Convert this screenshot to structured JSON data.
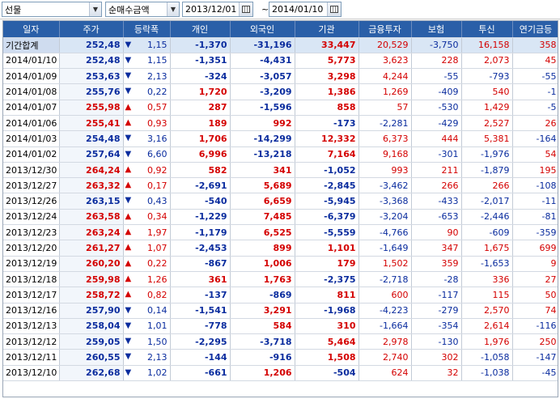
{
  "toolbar": {
    "market_select": "선물",
    "type_select": "순매수금액",
    "date_from": "2013/12/01",
    "date_to": "2014/01/10",
    "tilde": "~"
  },
  "table": {
    "headers": [
      "일자",
      "주가",
      "등락폭",
      "개인",
      "외국인",
      "기관",
      "금융투자",
      "보험",
      "투신",
      "연기금등"
    ],
    "rows": [
      {
        "date": "기간합계",
        "price": "252,48",
        "dir": "down",
        "change": "1,15",
        "individual": "-1,370",
        "foreign": "-31,196",
        "institution": "33,447",
        "financial": "20,529",
        "insurance": "-3,750",
        "trust": "16,158",
        "pension": "358"
      },
      {
        "date": "2014/01/10",
        "price": "252,48",
        "dir": "down",
        "change": "1,15",
        "individual": "-1,351",
        "foreign": "-4,431",
        "institution": "5,773",
        "financial": "3,623",
        "insurance": "228",
        "trust": "2,073",
        "pension": "45"
      },
      {
        "date": "2014/01/09",
        "price": "253,63",
        "dir": "down",
        "change": "2,13",
        "individual": "-324",
        "foreign": "-3,057",
        "institution": "3,298",
        "financial": "4,244",
        "insurance": "-55",
        "trust": "-793",
        "pension": "-55"
      },
      {
        "date": "2014/01/08",
        "price": "255,76",
        "dir": "down",
        "change": "0,22",
        "individual": "1,720",
        "foreign": "-3,209",
        "institution": "1,386",
        "financial": "1,269",
        "insurance": "-409",
        "trust": "540",
        "pension": "-1"
      },
      {
        "date": "2014/01/07",
        "price": "255,98",
        "dir": "up",
        "change": "0,57",
        "individual": "287",
        "foreign": "-1,596",
        "institution": "858",
        "financial": "57",
        "insurance": "-530",
        "trust": "1,429",
        "pension": "-5"
      },
      {
        "date": "2014/01/06",
        "price": "255,41",
        "dir": "up",
        "change": "0,93",
        "individual": "189",
        "foreign": "992",
        "institution": "-173",
        "financial": "-2,281",
        "insurance": "-429",
        "trust": "2,527",
        "pension": "26"
      },
      {
        "date": "2014/01/03",
        "price": "254,48",
        "dir": "down",
        "change": "3,16",
        "individual": "1,706",
        "foreign": "-14,299",
        "institution": "12,332",
        "financial": "6,373",
        "insurance": "444",
        "trust": "5,381",
        "pension": "-164"
      },
      {
        "date": "2014/01/02",
        "price": "257,64",
        "dir": "down",
        "change": "6,60",
        "individual": "6,996",
        "foreign": "-13,218",
        "institution": "7,164",
        "financial": "9,168",
        "insurance": "-301",
        "trust": "-1,976",
        "pension": "54"
      },
      {
        "date": "2013/12/30",
        "price": "264,24",
        "dir": "up",
        "change": "0,92",
        "individual": "582",
        "foreign": "341",
        "institution": "-1,052",
        "financial": "993",
        "insurance": "211",
        "trust": "-1,879",
        "pension": "195"
      },
      {
        "date": "2013/12/27",
        "price": "263,32",
        "dir": "up",
        "change": "0,17",
        "individual": "-2,691",
        "foreign": "5,689",
        "institution": "-2,845",
        "financial": "-3,462",
        "insurance": "266",
        "trust": "266",
        "pension": "-108"
      },
      {
        "date": "2013/12/26",
        "price": "263,15",
        "dir": "down",
        "change": "0,43",
        "individual": "-540",
        "foreign": "6,659",
        "institution": "-5,945",
        "financial": "-3,368",
        "insurance": "-433",
        "trust": "-2,017",
        "pension": "-11"
      },
      {
        "date": "2013/12/24",
        "price": "263,58",
        "dir": "up",
        "change": "0,34",
        "individual": "-1,229",
        "foreign": "7,485",
        "institution": "-6,379",
        "financial": "-3,204",
        "insurance": "-653",
        "trust": "-2,446",
        "pension": "-81"
      },
      {
        "date": "2013/12/23",
        "price": "263,24",
        "dir": "up",
        "change": "1,97",
        "individual": "-1,179",
        "foreign": "6,525",
        "institution": "-5,559",
        "financial": "-4,766",
        "insurance": "90",
        "trust": "-609",
        "pension": "-359"
      },
      {
        "date": "2013/12/20",
        "price": "261,27",
        "dir": "up",
        "change": "1,07",
        "individual": "-2,453",
        "foreign": "899",
        "institution": "1,101",
        "financial": "-1,649",
        "insurance": "347",
        "trust": "1,675",
        "pension": "699"
      },
      {
        "date": "2013/12/19",
        "price": "260,20",
        "dir": "up",
        "change": "0,22",
        "individual": "-867",
        "foreign": "1,006",
        "institution": "179",
        "financial": "1,502",
        "insurance": "359",
        "trust": "-1,653",
        "pension": "9"
      },
      {
        "date": "2013/12/18",
        "price": "259,98",
        "dir": "up",
        "change": "1,26",
        "individual": "361",
        "foreign": "1,763",
        "institution": "-2,375",
        "financial": "-2,718",
        "insurance": "-28",
        "trust": "336",
        "pension": "27"
      },
      {
        "date": "2013/12/17",
        "price": "258,72",
        "dir": "up",
        "change": "0,82",
        "individual": "-137",
        "foreign": "-869",
        "institution": "811",
        "financial": "600",
        "insurance": "-117",
        "trust": "115",
        "pension": "50"
      },
      {
        "date": "2013/12/16",
        "price": "257,90",
        "dir": "down",
        "change": "0,14",
        "individual": "-1,541",
        "foreign": "3,291",
        "institution": "-1,968",
        "financial": "-4,223",
        "insurance": "-279",
        "trust": "2,570",
        "pension": "74"
      },
      {
        "date": "2013/12/13",
        "price": "258,04",
        "dir": "down",
        "change": "1,01",
        "individual": "-778",
        "foreign": "584",
        "institution": "310",
        "financial": "-1,664",
        "insurance": "-354",
        "trust": "2,614",
        "pension": "-116"
      },
      {
        "date": "2013/12/12",
        "price": "259,05",
        "dir": "down",
        "change": "1,50",
        "individual": "-2,295",
        "foreign": "-3,718",
        "institution": "5,464",
        "financial": "2,978",
        "insurance": "-130",
        "trust": "1,976",
        "pension": "250"
      },
      {
        "date": "2013/12/11",
        "price": "260,55",
        "dir": "down",
        "change": "2,13",
        "individual": "-144",
        "foreign": "-916",
        "institution": "1,508",
        "financial": "2,740",
        "insurance": "302",
        "trust": "-1,058",
        "pension": "-147"
      },
      {
        "date": "2013/12/10",
        "price": "262,68",
        "dir": "down",
        "change": "1,02",
        "individual": "-661",
        "foreign": "1,206",
        "institution": "-504",
        "financial": "624",
        "insurance": "32",
        "trust": "-1,038",
        "pension": "-45"
      }
    ]
  },
  "colors": {
    "header_bg": "#2a5fa8",
    "up": "#d40000",
    "down": "#0a2c9e",
    "summary_bg": "#d9e6f5"
  },
  "icons": {
    "dropdown": "chevron-down-icon",
    "calendar": "calendar-icon",
    "up": "triangle-up-icon",
    "down": "triangle-down-icon"
  }
}
